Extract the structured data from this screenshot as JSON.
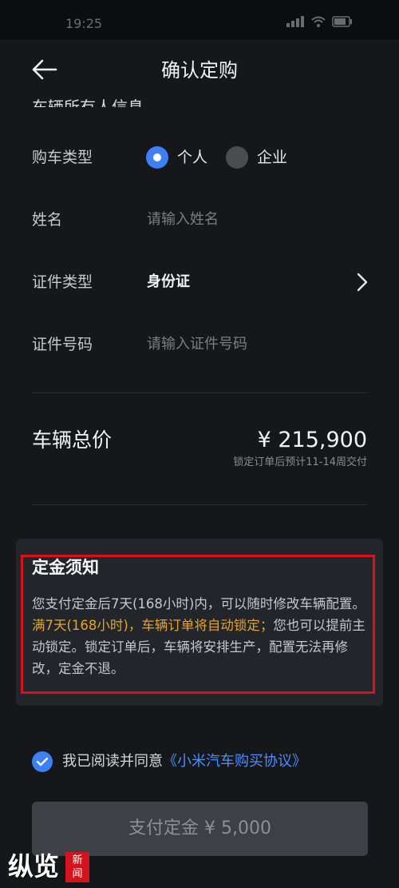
{
  "status_bar": {
    "time": "19:25",
    "icons": [
      "signal-icon",
      "wifi-icon",
      "battery-icon"
    ]
  },
  "nav": {
    "title": "确认定购",
    "back_icon": "arrow-left-icon"
  },
  "owner_section": {
    "header": "车辆所有人信息"
  },
  "form": {
    "buyer_type": {
      "label": "购车类型",
      "options": [
        "个人",
        "企业"
      ],
      "selected": "个人"
    },
    "name": {
      "label": "姓名",
      "placeholder": "请输入姓名"
    },
    "id_type": {
      "label": "证件类型",
      "value": "身份证"
    },
    "id_number": {
      "label": "证件号码",
      "placeholder": "请输入证件号码"
    }
  },
  "total": {
    "label": "车辆总价",
    "price": "¥ 215,900",
    "delivery_note": "锁定订单后预计11-14周交付"
  },
  "deposit_notice": {
    "title": "定金须知",
    "line1": "您支付定金后7天(168小时)内，可以随时修改车辆配置。",
    "highlight": "满7天(168小时)，车辆订单将自动锁定；",
    "line2": "您也可以提前主动锁定。锁定订单后，车辆将安排生产，配置无法再修改，定金不退。"
  },
  "agreement": {
    "text": "我已阅读并同意",
    "link": "《小米汽车购买协议》",
    "checked": true
  },
  "pay_button": {
    "label": "支付定金 ¥ 5,000"
  },
  "watermark": {
    "brand": "纵览",
    "badge": "新闻"
  },
  "colors": {
    "background": "#15171b",
    "accent": "#3d7ff5",
    "highlight_orange": "#e6a42c",
    "annotation_red": "#d9121a"
  }
}
